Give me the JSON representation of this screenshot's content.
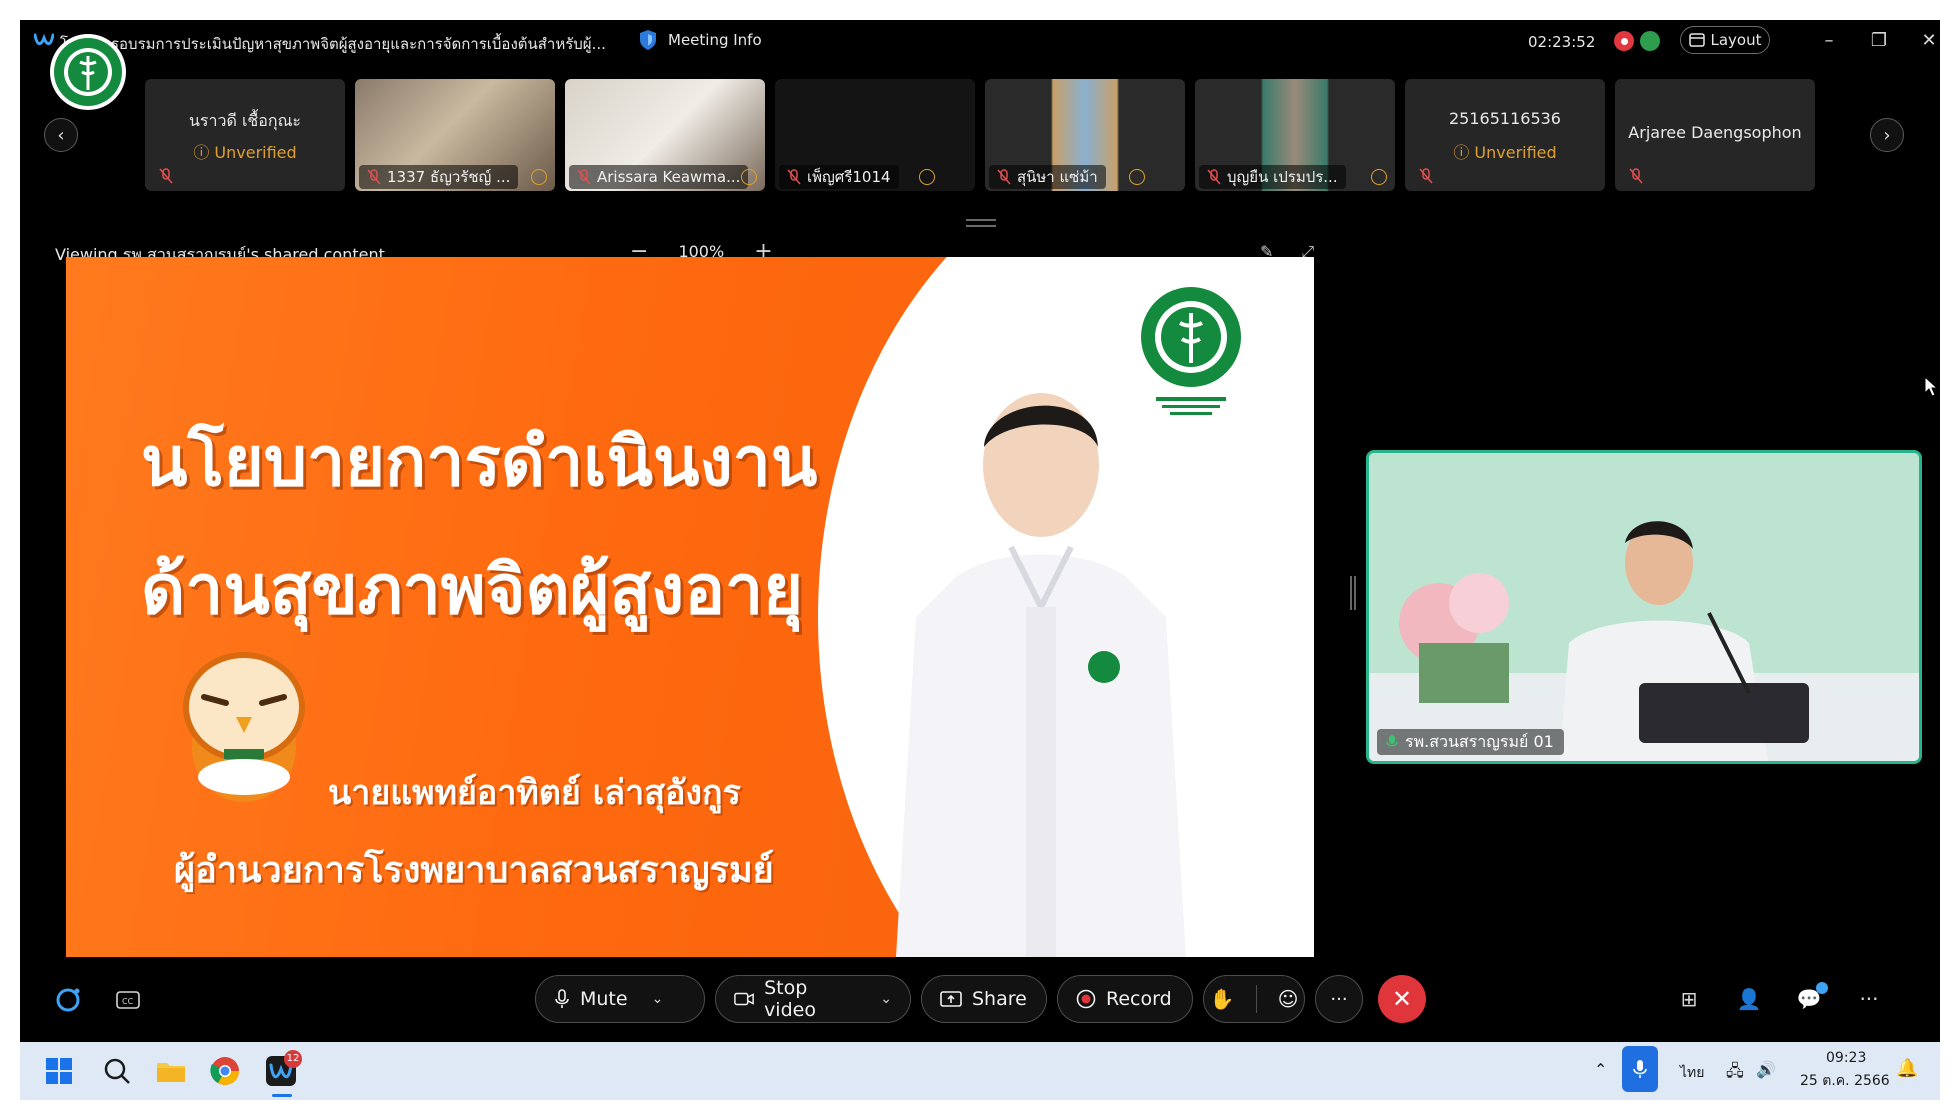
{
  "window": {
    "title": "โครงการอบรมการประเมินปัญหาสุขภาพจิตผู้สูงอายุและการจัดการเบื้องต้นสำหรับผู้...",
    "meeting_info_label": "Meeting Info",
    "timer": "02:23:52",
    "layout_label": "Layout"
  },
  "participants": [
    {
      "name": "นราวดี เชื้อกุณะ",
      "status": "Unverified",
      "video": false
    },
    {
      "name": "1337 ธัญวรัชญ์ ...",
      "status": "",
      "video": true
    },
    {
      "name": "Arissara Keawma...",
      "status": "",
      "video": true
    },
    {
      "name": "เพ็ญศรี1014",
      "status": "",
      "video": true
    },
    {
      "name": "สุนิษา แซ่ม้า",
      "status": "",
      "video": true
    },
    {
      "name": "บุญยืน เปรมปร...",
      "status": "",
      "video": true
    },
    {
      "name": "25165116536",
      "status": "Unverified",
      "video": false
    },
    {
      "name": "Arjaree Daengsophon",
      "status": "",
      "video": false
    }
  ],
  "share": {
    "viewing_text": "Viewing รพ.สวนสราญรมย์'s shared content",
    "zoom": "100%"
  },
  "slide": {
    "line1": "นโยบายการดำเนินงาน",
    "line2": "ด้านสุขภาพจิตผู้สูงอายุ",
    "line3": "นายแพทย์อาทิตย์  เล่าสุอังกูร",
    "line4": "ผู้อำนวยการโรงพยาบาลสวนสราญรมย์"
  },
  "speaker": {
    "label": "รพ.สวนสราญรมย์ 01"
  },
  "controls": {
    "mute": "Mute",
    "stop_video": "Stop video",
    "share": "Share",
    "record": "Record"
  },
  "taskbar": {
    "webex_badge": "12",
    "lang": "ไทย",
    "time": "09:23",
    "date": "25 ต.ค. 2566"
  },
  "colors": {
    "accent_orange": "#ff6a10",
    "speaker_border": "#28b48c",
    "end_call": "#e0353a",
    "unverified": "#e0a030"
  },
  "icons": [
    "webex-logo-icon",
    "shield-icon",
    "record-indicator-icon",
    "network-icon",
    "layout-icon",
    "minimize-icon",
    "restore-icon",
    "close-icon",
    "chevron-left-icon",
    "chevron-right-icon",
    "mic-off-icon",
    "info-icon",
    "zoom-out-icon",
    "zoom-in-icon",
    "annotate-icon",
    "fullscreen-icon",
    "mic-icon",
    "video-icon",
    "share-icon",
    "record-icon",
    "raise-hand-icon",
    "reactions-icon",
    "more-icon",
    "end-call-icon",
    "apps-icon",
    "participants-icon",
    "chat-icon",
    "windows-start-icon",
    "search-icon",
    "file-explorer-icon",
    "chrome-icon",
    "webex-icon"
  ]
}
